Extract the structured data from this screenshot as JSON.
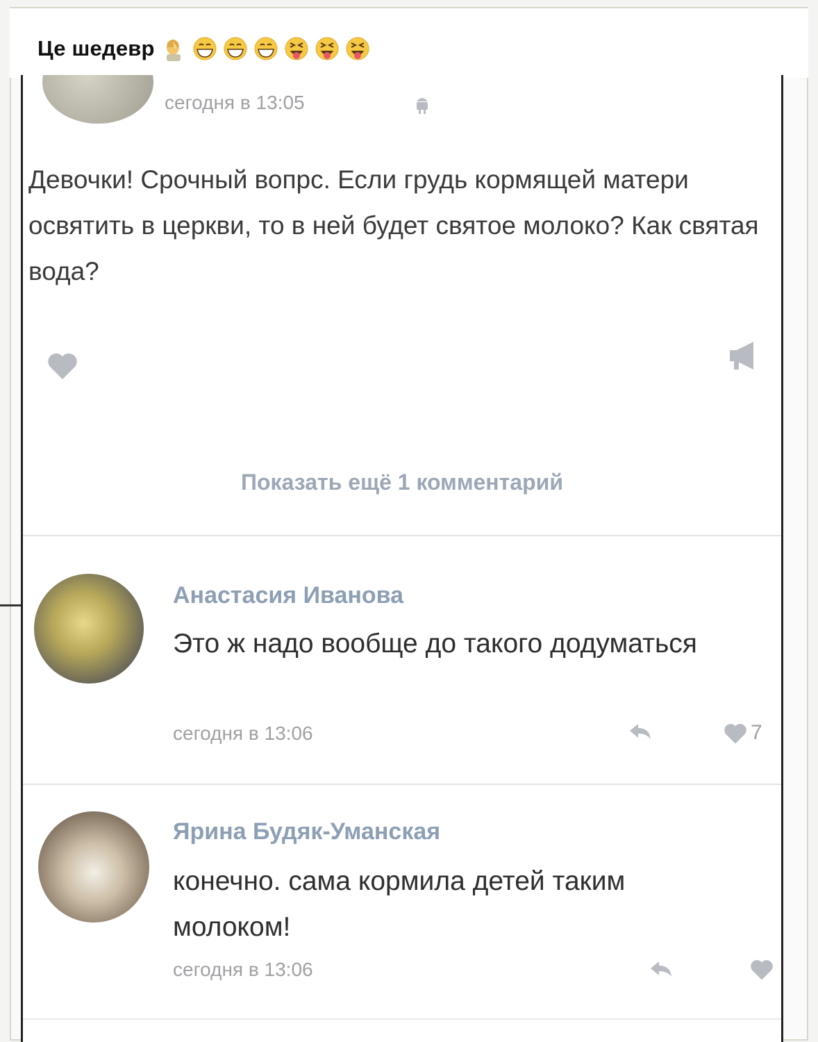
{
  "caption": {
    "text": "Це шедевр",
    "emojis": [
      "facepalm-emoji",
      "grin-emoji",
      "grin-emoji",
      "grin-emoji",
      "squint-tongue-emoji",
      "squint-tongue-emoji",
      "squint-tongue-emoji"
    ]
  },
  "post": {
    "timestamp": "сегодня в 13:05",
    "text": "Девочки! Срочный вопрс. Если грудь кормящей матери освятить в церкви, то в ней будет святое молоко? Как святая вода?",
    "icons": [
      "heart-icon",
      "megaphone-icon"
    ]
  },
  "show_more": "Показать ещё 1 комментарий",
  "comments": [
    {
      "author": "Анастасия Иванова",
      "text": "Это ж надо вообще до такого додуматься",
      "timestamp": "сегодня в 13:06",
      "likes": "7"
    },
    {
      "author": "Ярина Будяк-Уманская",
      "text": "конечно. сама кормила детей таким молоком!",
      "timestamp": "сегодня в 13:06"
    }
  ],
  "colors": {
    "name": "#8c9fb4",
    "meta": "#9ea0a3",
    "icon": "#b8bcc2"
  }
}
